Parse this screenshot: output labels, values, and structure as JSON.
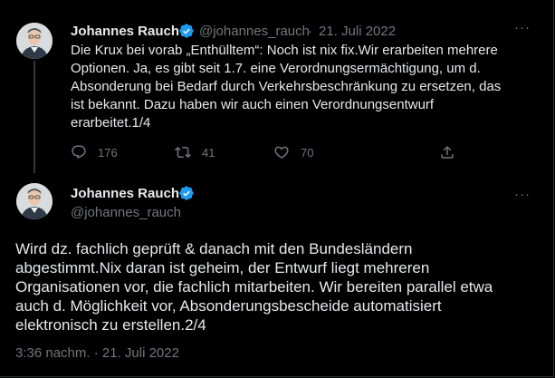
{
  "tweet1": {
    "author_name": "Johannes Rauch",
    "handle": "@johannes_rauch",
    "separator": "·",
    "date": "21. Juli 2022",
    "text": "Die Krux bei vorab „Enthülltem“: Noch ist nix fix.Wir erarbeiten mehrere\nOptionen. Ja, es gibt seit 1.7. eine Verordnungsermächtigung, um d.\nAbsonderung bei Bedarf durch Verkehrsbeschränkung zu ersetzen, das\nist bekannt. Dazu haben wir auch einen Verordnungsentwurf\nerarbeitet.1/4",
    "actions": {
      "reply_count": "176",
      "retweet_count": "41",
      "like_count": "70"
    }
  },
  "tweet2": {
    "author_name": "Johannes Rauch",
    "handle": "@johannes_rauch",
    "text": "Wird dz. fachlich geprüft & danach mit den Bundesländern\nabgestimmt.Nix daran ist geheim, der Entwurf liegt mehreren\nOrganisationen vor, die fachlich mitarbeiten. Wir bereiten parallel etwa\nauch d. Möglichkeit vor, Absonderungsbescheide automatisiert\nelektronisch zu erstellen.2/4",
    "timestamp": "3:36 nachm. · 21. Juli 2022"
  },
  "icons": {
    "more": "more-icon",
    "verified": "verified-badge-icon",
    "reply": "reply-icon",
    "retweet": "retweet-icon",
    "like": "like-icon",
    "share": "share-icon"
  },
  "colors": {
    "background": "#000000",
    "text_primary": "#e7e9ea",
    "text_secondary": "#71767b",
    "verified": "#1d9bf0",
    "border": "#2f3336"
  }
}
